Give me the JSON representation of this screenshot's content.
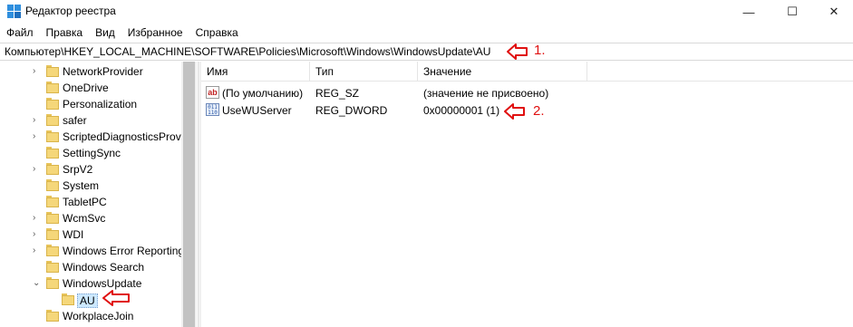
{
  "window": {
    "title": "Редактор реестра",
    "controls": {
      "minimize": "—",
      "maximize": "☐",
      "close": "✕"
    }
  },
  "menu": [
    "Файл",
    "Правка",
    "Вид",
    "Избранное",
    "Справка"
  ],
  "address": {
    "path": "Компьютер\\HKEY_LOCAL_MACHINE\\SOFTWARE\\Policies\\Microsoft\\Windows\\WindowsUpdate\\AU"
  },
  "annotations": {
    "marker1": "1.",
    "marker2": "2.",
    "color": "#e01010"
  },
  "tree": {
    "items": [
      {
        "label": "NetworkProvider",
        "expander": "›"
      },
      {
        "label": "OneDrive",
        "expander": ""
      },
      {
        "label": "Personalization",
        "expander": ""
      },
      {
        "label": "safer",
        "expander": "›"
      },
      {
        "label": "ScriptedDiagnosticsProv",
        "expander": "›"
      },
      {
        "label": "SettingSync",
        "expander": ""
      },
      {
        "label": "SrpV2",
        "expander": "›"
      },
      {
        "label": "System",
        "expander": ""
      },
      {
        "label": "TabletPC",
        "expander": ""
      },
      {
        "label": "WcmSvc",
        "expander": "›"
      },
      {
        "label": "WDI",
        "expander": "›"
      },
      {
        "label": "Windows Error Reporting",
        "expander": "›"
      },
      {
        "label": "Windows Search",
        "expander": ""
      },
      {
        "label": "WindowsUpdate",
        "expander": "⌄"
      },
      {
        "label": "AU",
        "expander": ""
      },
      {
        "label": "WorkplaceJoin",
        "expander": ""
      }
    ],
    "selected": "AU"
  },
  "list": {
    "columns": {
      "name": "Имя",
      "type": "Тип",
      "value": "Значение"
    },
    "rows": [
      {
        "icon": "string-value-icon",
        "icon_text": "ab",
        "name": "(По умолчанию)",
        "type": "REG_SZ",
        "value": "(значение не присвоено)"
      },
      {
        "icon": "binary-value-icon",
        "icon_text": "011 110",
        "name": "UseWUServer",
        "type": "REG_DWORD",
        "value": "0x00000001 (1)"
      }
    ]
  }
}
